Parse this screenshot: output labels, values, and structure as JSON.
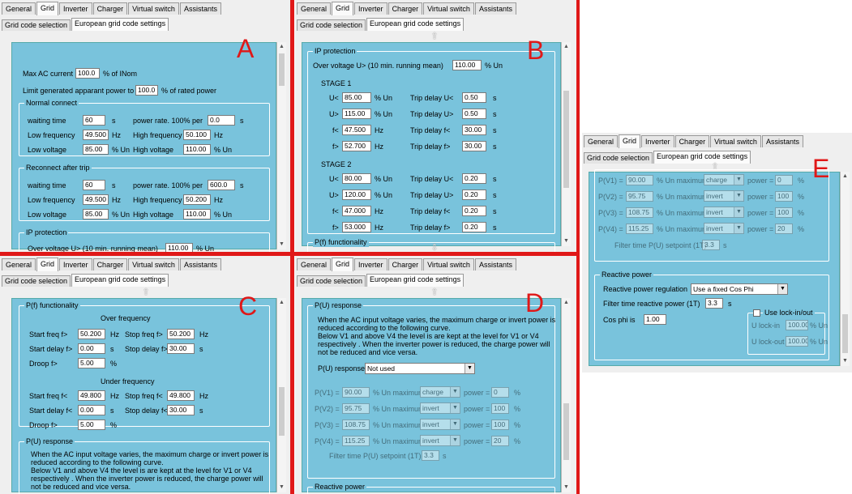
{
  "tabs": [
    "General",
    "Grid",
    "Inverter",
    "Charger",
    "Virtual switch",
    "Assistants"
  ],
  "subtabs": [
    "Grid code selection",
    "European grid code settings"
  ],
  "letters": {
    "a": "A",
    "b": "B",
    "c": "C",
    "d": "D",
    "e": "E"
  },
  "panel_a": {
    "max_ac_label": "Max AC current",
    "max_ac_value": "100.0",
    "max_ac_unit": "% of INom",
    "limit_label": "Limit generated apparant power to",
    "limit_value": "100.0",
    "limit_unit": "% of rated power",
    "normal": {
      "title": "Normal connect",
      "waiting_label": "waiting time",
      "waiting_value": "60",
      "waiting_unit": "s",
      "rate_label": "power rate. 100% per",
      "rate_value": "0.0",
      "rate_unit": "s",
      "lowf_label": "Low frequency",
      "lowf_value": "49.500",
      "lowf_unit": "Hz",
      "highf_label": "High frequency",
      "highf_value": "50.100",
      "highf_unit": "Hz",
      "lowv_label": "Low voltage",
      "lowv_value": "85.00",
      "lowv_unit": "% Un",
      "highv_label": "High voltage",
      "highv_value": "110.00",
      "highv_unit": "% Un"
    },
    "reconnect": {
      "title": "Reconnect after trip",
      "waiting_label": "waiting time",
      "waiting_value": "60",
      "waiting_unit": "s",
      "rate_label": "power rate. 100% per",
      "rate_value": "600.0",
      "rate_unit": "s",
      "lowf_label": "Low frequency",
      "lowf_value": "49.500",
      "lowf_unit": "Hz",
      "highf_label": "High frequency",
      "highf_value": "50.200",
      "highf_unit": "Hz",
      "lowv_label": "Low voltage",
      "lowv_value": "85.00",
      "lowv_unit": "% Un",
      "highv_label": "High voltage",
      "highv_value": "110.00",
      "highv_unit": "% Un"
    },
    "ip_title": "IP protection",
    "ip_partial": "Over voltage U> (10 min. running mean)",
    "ip_partial_value": "110.00",
    "ip_partial_unit": "% Un"
  },
  "panel_b": {
    "ip_title": "IP protection",
    "over_label": "Over voltage U> (10 min. running mean)",
    "over_value": "110.00",
    "over_unit": "% Un",
    "stage1": "STAGE 1",
    "stage2": "STAGE 2",
    "s1": [
      {
        "l": "U<",
        "v": "85.00",
        "u": "% Un",
        "tl": "Trip delay U<",
        "tv": "0.50",
        "tu": "s"
      },
      {
        "l": "U>",
        "v": "115.00",
        "u": "% Un",
        "tl": "Trip delay U>",
        "tv": "0.50",
        "tu": "s"
      },
      {
        "l": "f<",
        "v": "47.500",
        "u": "Hz",
        "tl": "Trip delay f<",
        "tv": "30.00",
        "tu": "s"
      },
      {
        "l": "f>",
        "v": "52.700",
        "u": "Hz",
        "tl": "Trip delay f>",
        "tv": "30.00",
        "tu": "s"
      }
    ],
    "s2": [
      {
        "l": "U<",
        "v": "80.00",
        "u": "% Un",
        "tl": "Trip delay U<",
        "tv": "0.20",
        "tu": "s"
      },
      {
        "l": "U>",
        "v": "120.00",
        "u": "% Un",
        "tl": "Trip delay U>",
        "tv": "0.20",
        "tu": "s"
      },
      {
        "l": "f<",
        "v": "47.000",
        "u": "Hz",
        "tl": "Trip delay f<",
        "tv": "0.20",
        "tu": "s"
      },
      {
        "l": "f>",
        "v": "53.000",
        "u": "Hz",
        "tl": "Trip delay f>",
        "tv": "0.20",
        "tu": "s"
      }
    ],
    "pf_title": "P(f) functionality"
  },
  "panel_c": {
    "pf_title": "P(f) functionality",
    "over": "Over frequency",
    "under": "Under frequency",
    "o_start_label": "Start freq f>",
    "o_start_value": "50.200",
    "o_start_unit": "Hz",
    "o_stop_label": "Stop freq f>",
    "o_stop_value": "50.200",
    "o_stop_unit": "Hz",
    "o_delay_label": "Start delay f>",
    "o_delay_value": "0.00",
    "o_delay_unit": "s",
    "o_sdelay_label": "Stop delay f>",
    "o_sdelay_value": "30.00",
    "o_sdelay_unit": "s",
    "o_droop_label": "Droop f>",
    "o_droop_value": "5.00",
    "o_droop_unit": "%",
    "u_start_label": "Start freq f<",
    "u_start_value": "49.800",
    "u_start_unit": "Hz",
    "u_stop_label": "Stop freq f<",
    "u_stop_value": "49.800",
    "u_stop_unit": "Hz",
    "u_delay_label": "Start delay f<",
    "u_delay_value": "0.00",
    "u_delay_unit": "s",
    "u_sdelay_label": "Stop delay f<",
    "u_sdelay_value": "30.00",
    "u_sdelay_unit": "s",
    "u_droop_label": "Droop f>",
    "u_droop_value": "5.00",
    "u_droop_unit": "%",
    "pu_title": "P(U) response",
    "pu_text": [
      "When the AC input voltage varies, the maximum charge or invert power is",
      "reduced according to the following curve.",
      "Below V1 and above V4 the level is are kept at the level for  V1 or  V4",
      "respectively . When the inverter power is reduced, the charge power will",
      "not be reduced and vice versa."
    ]
  },
  "panel_d": {
    "pu_title": "P(U) response",
    "pu_text": [
      "When the AC input voltage varies, the maximum charge or invert power is",
      "reduced according to the following curve.",
      "Below V1 and above V4 the level is are kept at the level for  V1 or  V4",
      "respectively . When the inverter power is reduced, the charge power will",
      "not be reduced and vice versa."
    ],
    "pu_label": "P(U) response",
    "pu_value": "Not used",
    "rows": [
      {
        "l": "P(V1) =",
        "v": "90.00",
        "u": "% Un  maximum",
        "m": "charge",
        "pl": "power =",
        "pv": "0",
        "pu": "%"
      },
      {
        "l": "P(V2) =",
        "v": "95.75",
        "u": "% Un  maximum",
        "m": "invert",
        "pl": "power =",
        "pv": "100",
        "pu": "%"
      },
      {
        "l": "P(V3) =",
        "v": "108.75",
        "u": "% Un  maximum",
        "m": "invert",
        "pl": "power =",
        "pv": "100",
        "pu": "%"
      },
      {
        "l": "P(V4) =",
        "v": "115.25",
        "u": "% Un  maximum",
        "m": "invert",
        "pl": "power =",
        "pv": "20",
        "pu": "%"
      }
    ],
    "filter_label": "Filter time P(U) setpoint (1T)",
    "filter_value": "3.3",
    "filter_unit": "s",
    "rp_title": "Reactive power"
  },
  "panel_e": {
    "rows": [
      {
        "l": "P(V1) =",
        "v": "90.00",
        "u": "% Un  maximum",
        "m": "charge",
        "pl": "power =",
        "pv": "0",
        "pu": "%"
      },
      {
        "l": "P(V2) =",
        "v": "95.75",
        "u": "% Un  maximum",
        "m": "invert",
        "pl": "power =",
        "pv": "100",
        "pu": "%"
      },
      {
        "l": "P(V3) =",
        "v": "108.75",
        "u": "% Un  maximum",
        "m": "invert",
        "pl": "power =",
        "pv": "100",
        "pu": "%"
      },
      {
        "l": "P(V4) =",
        "v": "115.25",
        "u": "% Un  maximum",
        "m": "invert",
        "pl": "power =",
        "pv": "20",
        "pu": "%"
      }
    ],
    "filter_label": "Filter time P(U) setpoint (1T)",
    "filter_value": "3.3",
    "filter_unit": "s",
    "rp_title": "Reactive power",
    "reg_label": "Reactive power regulation",
    "reg_value": "Use a fixed Cos Phi",
    "frp_label": "Filter time reactive power (1T)",
    "frp_value": "3.3",
    "frp_unit": "s",
    "cos_label": "Cos phi is",
    "cos_value": "1.00",
    "lock_label": "Use lock-in/out",
    "lockin_label": "U lock-in",
    "lockin_value": "100.00",
    "lockin_unit": "% Un",
    "lockout_label": "U lock-out",
    "lockout_value": "100.00",
    "lockout_unit": "% Un"
  },
  "colors": {
    "highlight": "#e01818",
    "area": "#79c3dc"
  }
}
